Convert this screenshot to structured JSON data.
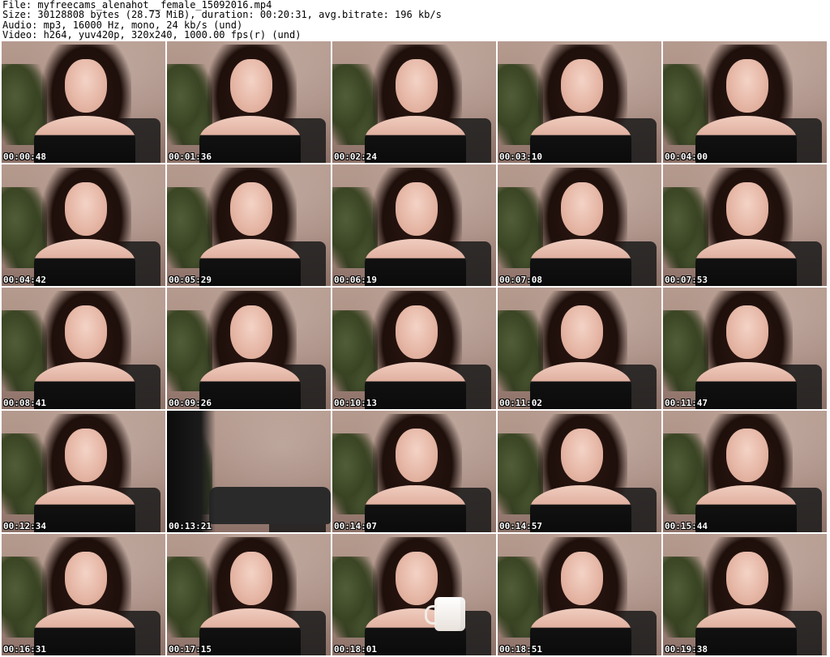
{
  "header": {
    "file_line": "File: myfreecams_alenahot__female_15092016.mp4",
    "size_line": "Size: 30128808 bytes (28.73 MiB), duration: 00:20:31, avg.bitrate: 196 kb/s",
    "audio_line": "Audio: mp3, 16000 Hz, mono, 24 kb/s (und)",
    "video_line": "Video: h264, yuv420p, 320x240, 1000.00 fps(r) (und)"
  },
  "thumbnails": [
    {
      "timestamp": "00:00:48",
      "variant": "normal"
    },
    {
      "timestamp": "00:01:36",
      "variant": "normal"
    },
    {
      "timestamp": "00:02:24",
      "variant": "normal"
    },
    {
      "timestamp": "00:03:10",
      "variant": "normal"
    },
    {
      "timestamp": "00:04:00",
      "variant": "normal"
    },
    {
      "timestamp": "00:04:42",
      "variant": "normal"
    },
    {
      "timestamp": "00:05:29",
      "variant": "normal"
    },
    {
      "timestamp": "00:06:19",
      "variant": "normal"
    },
    {
      "timestamp": "00:07:08",
      "variant": "normal"
    },
    {
      "timestamp": "00:07:53",
      "variant": "normal"
    },
    {
      "timestamp": "00:08:41",
      "variant": "normal"
    },
    {
      "timestamp": "00:09:26",
      "variant": "normal"
    },
    {
      "timestamp": "00:10:13",
      "variant": "normal"
    },
    {
      "timestamp": "00:11:02",
      "variant": "normal"
    },
    {
      "timestamp": "00:11:47",
      "variant": "normal"
    },
    {
      "timestamp": "00:12:34",
      "variant": "normal"
    },
    {
      "timestamp": "00:13:21",
      "variant": "away"
    },
    {
      "timestamp": "00:14:07",
      "variant": "normal"
    },
    {
      "timestamp": "00:14:57",
      "variant": "normal"
    },
    {
      "timestamp": "00:15:44",
      "variant": "normal"
    },
    {
      "timestamp": "00:16:31",
      "variant": "normal"
    },
    {
      "timestamp": "00:17:15",
      "variant": "normal"
    },
    {
      "timestamp": "00:18:01",
      "variant": "mug"
    },
    {
      "timestamp": "00:18:51",
      "variant": "normal"
    },
    {
      "timestamp": "00:19:38",
      "variant": "normal"
    }
  ]
}
